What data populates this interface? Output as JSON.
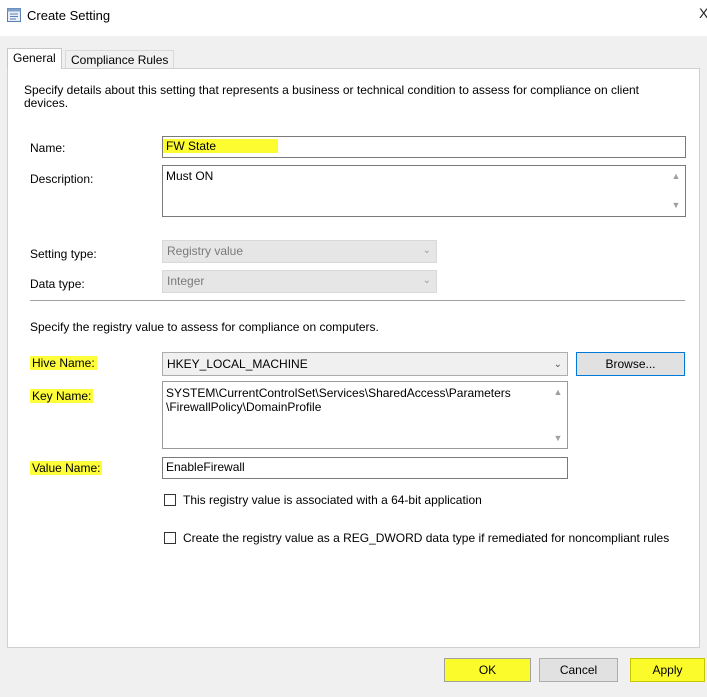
{
  "window": {
    "title": "Create Setting",
    "close_glyph": "X"
  },
  "tabs": [
    {
      "label": "General",
      "active": true
    },
    {
      "label": "Compliance Rules",
      "active": false
    }
  ],
  "general": {
    "intro": "Specify details about this setting that represents a business or technical condition to assess for compliance on client devices.",
    "name_label": "Name:",
    "name_value": "FW State",
    "description_label": "Description:",
    "description_value": "Must ON",
    "setting_type_label": "Setting type:",
    "setting_type_value": "Registry value",
    "data_type_label": "Data type:",
    "data_type_value": "Integer"
  },
  "registry": {
    "intro": "Specify the registry value to assess for compliance on computers.",
    "hive_label": "Hive Name:",
    "hive_value": "HKEY_LOCAL_MACHINE",
    "browse_label": "Browse...",
    "key_label": "Key Name:",
    "key_line1": "SYSTEM\\CurrentControlSet\\Services\\SharedAccess\\Parameters",
    "key_line2": "\\FirewallPolicy\\DomainProfile",
    "value_label": "Value Name:",
    "value_value": "EnableFirewall",
    "checkbox_64bit_label": "This registry value is associated with a 64-bit application",
    "checkbox_64bit_checked": false,
    "checkbox_dword_label": "Create the registry value as a REG_DWORD data type if remediated for noncompliant rules",
    "checkbox_dword_checked": false
  },
  "buttons": {
    "ok": "OK",
    "cancel": "Cancel",
    "apply": "Apply"
  },
  "highlight_color": "#fbfb2c",
  "icons": {
    "app": "dialog-icon",
    "scroll_up": "chevron-up-icon",
    "scroll_down": "chevron-down-icon",
    "combo": "chevron-down-icon"
  }
}
